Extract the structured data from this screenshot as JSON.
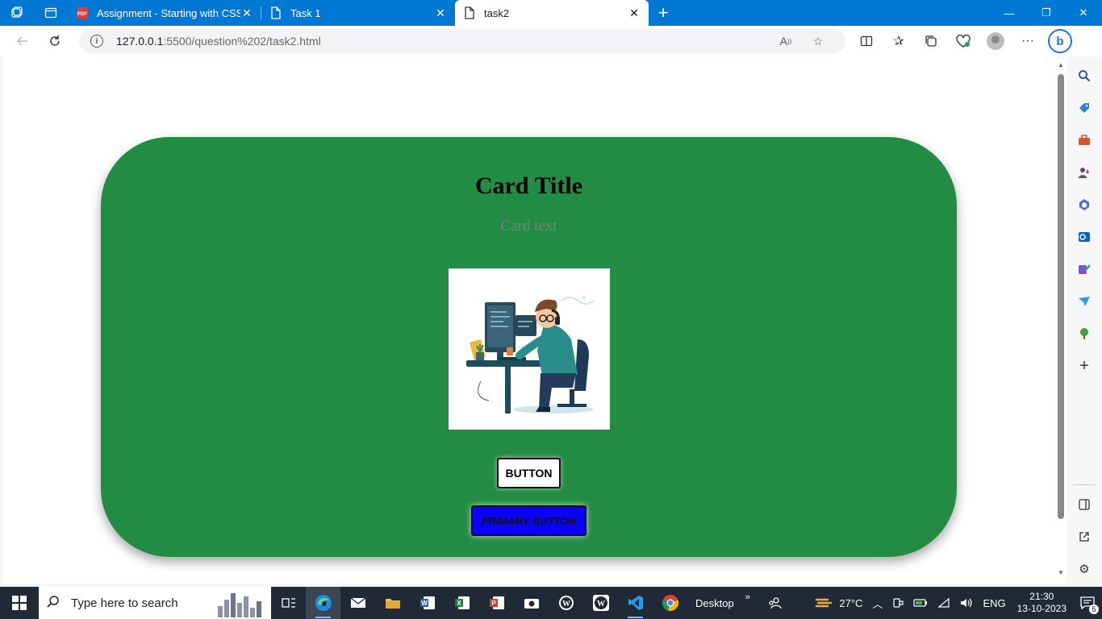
{
  "browser": {
    "tabs": [
      {
        "label": "Assignment - Starting with CSS.p",
        "icon": "pdf-icon",
        "active": false
      },
      {
        "label": "Task 1",
        "icon": "document-icon",
        "active": false
      },
      {
        "label": "task2",
        "icon": "document-icon",
        "active": true
      }
    ],
    "address": {
      "host": "127.0.0.1",
      "path": ":5500/question%202/task2.html"
    }
  },
  "card": {
    "title": "Card Title",
    "text": "Card text",
    "image_alt": "developer illustration",
    "button_label": "BUTTON",
    "primary_button_label": "PRIMARY BUTTON"
  },
  "taskbar": {
    "search_placeholder": "Type here to search",
    "desktop_label": "Desktop",
    "temperature": "27°C",
    "language": "ENG",
    "time": "21:30",
    "date": "13-10-2023",
    "notification_count": "5"
  },
  "colors": {
    "card_bg": "#238c44",
    "primary_button_bg": "#0a00ff",
    "titlebar": "#0078d4"
  }
}
